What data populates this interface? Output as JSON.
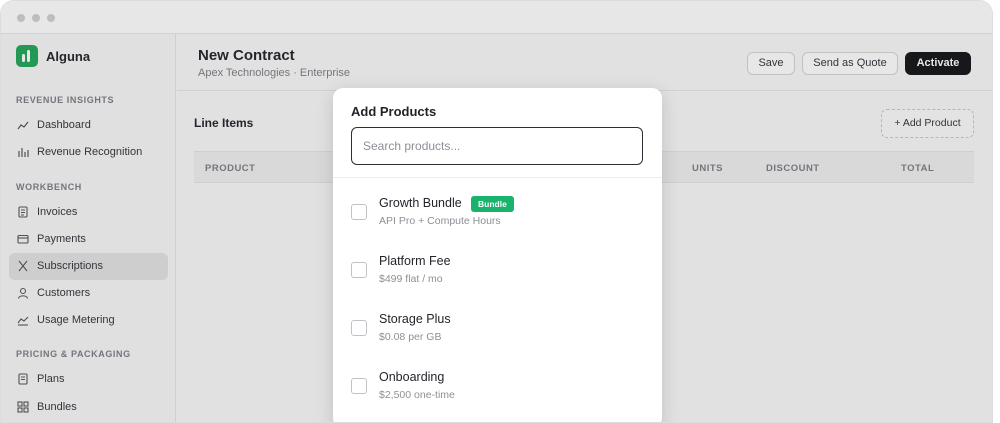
{
  "app": {
    "brand": "Alguna"
  },
  "sidebar": {
    "sections": [
      {
        "title": "REVENUE INSIGHTS"
      },
      {
        "title": "WORKBENCH"
      },
      {
        "title": "PRICING & PACKAGING"
      }
    ],
    "items": [
      {
        "label": "Dashboard",
        "icon": "trend-line-icon"
      },
      {
        "label": "Revenue Recognition",
        "icon": "bar-chart-icon"
      },
      {
        "label": "Invoices",
        "icon": "document-icon"
      },
      {
        "label": "Payments",
        "icon": "credit-card-icon"
      },
      {
        "label": "Subscriptions",
        "icon": "subscriptions-icon",
        "active": true
      },
      {
        "label": "Customers",
        "icon": "user-icon"
      },
      {
        "label": "Usage Metering",
        "icon": "area-chart-icon"
      },
      {
        "label": "Plans",
        "icon": "document-icon"
      },
      {
        "label": "Bundles",
        "icon": "grid-icon"
      }
    ]
  },
  "header": {
    "title": "New Contract",
    "subtitle": "Apex Technologies · Enterprise",
    "save_label": "Save",
    "quote_label": "Send as Quote",
    "activate_label": "Activate"
  },
  "line_items": {
    "title": "Line Items",
    "add_label": "+ Add Product",
    "columns": [
      "PRODUCT",
      "UNITS",
      "DISCOUNT",
      "TOTAL"
    ]
  },
  "modal": {
    "title": "Add Products",
    "search_placeholder": "Search products...",
    "products": [
      {
        "name": "Growth Bundle",
        "desc": "API Pro + Compute Hours",
        "badge": "Bundle",
        "checked": false
      },
      {
        "name": "Platform Fee",
        "desc": "$499 flat / mo",
        "checked": false
      },
      {
        "name": "Storage Plus",
        "desc": "$0.08 per GB",
        "checked": false
      },
      {
        "name": "Onboarding",
        "desc": "$2,500 one-time",
        "checked": false
      }
    ]
  },
  "colors": {
    "accent": "#22a559",
    "badge": "#19b36b",
    "primary_button": "#121417"
  }
}
